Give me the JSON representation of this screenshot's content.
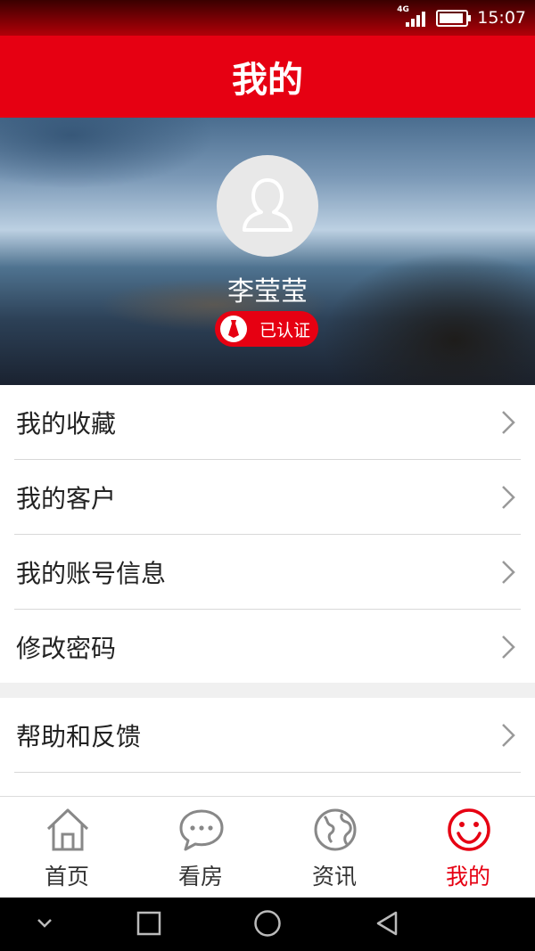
{
  "status_bar": {
    "network": "4G",
    "time": "15:07"
  },
  "header": {
    "title": "我的"
  },
  "profile": {
    "name": "李莹莹",
    "verified_label": "已认证"
  },
  "menu": {
    "group1": [
      {
        "label": "我的收藏"
      },
      {
        "label": "我的客户"
      },
      {
        "label": "我的账号信息"
      },
      {
        "label": "修改密码"
      }
    ],
    "group2": [
      {
        "label": "帮助和反馈"
      }
    ]
  },
  "tabs": [
    {
      "label": "首页",
      "icon": "home-icon"
    },
    {
      "label": "看房",
      "icon": "chat-bubble-icon"
    },
    {
      "label": "资讯",
      "icon": "globe-icon"
    },
    {
      "label": "我的",
      "icon": "smiley-icon"
    }
  ],
  "colors": {
    "brand": "#e60012",
    "inactive_tab": "#888888"
  }
}
